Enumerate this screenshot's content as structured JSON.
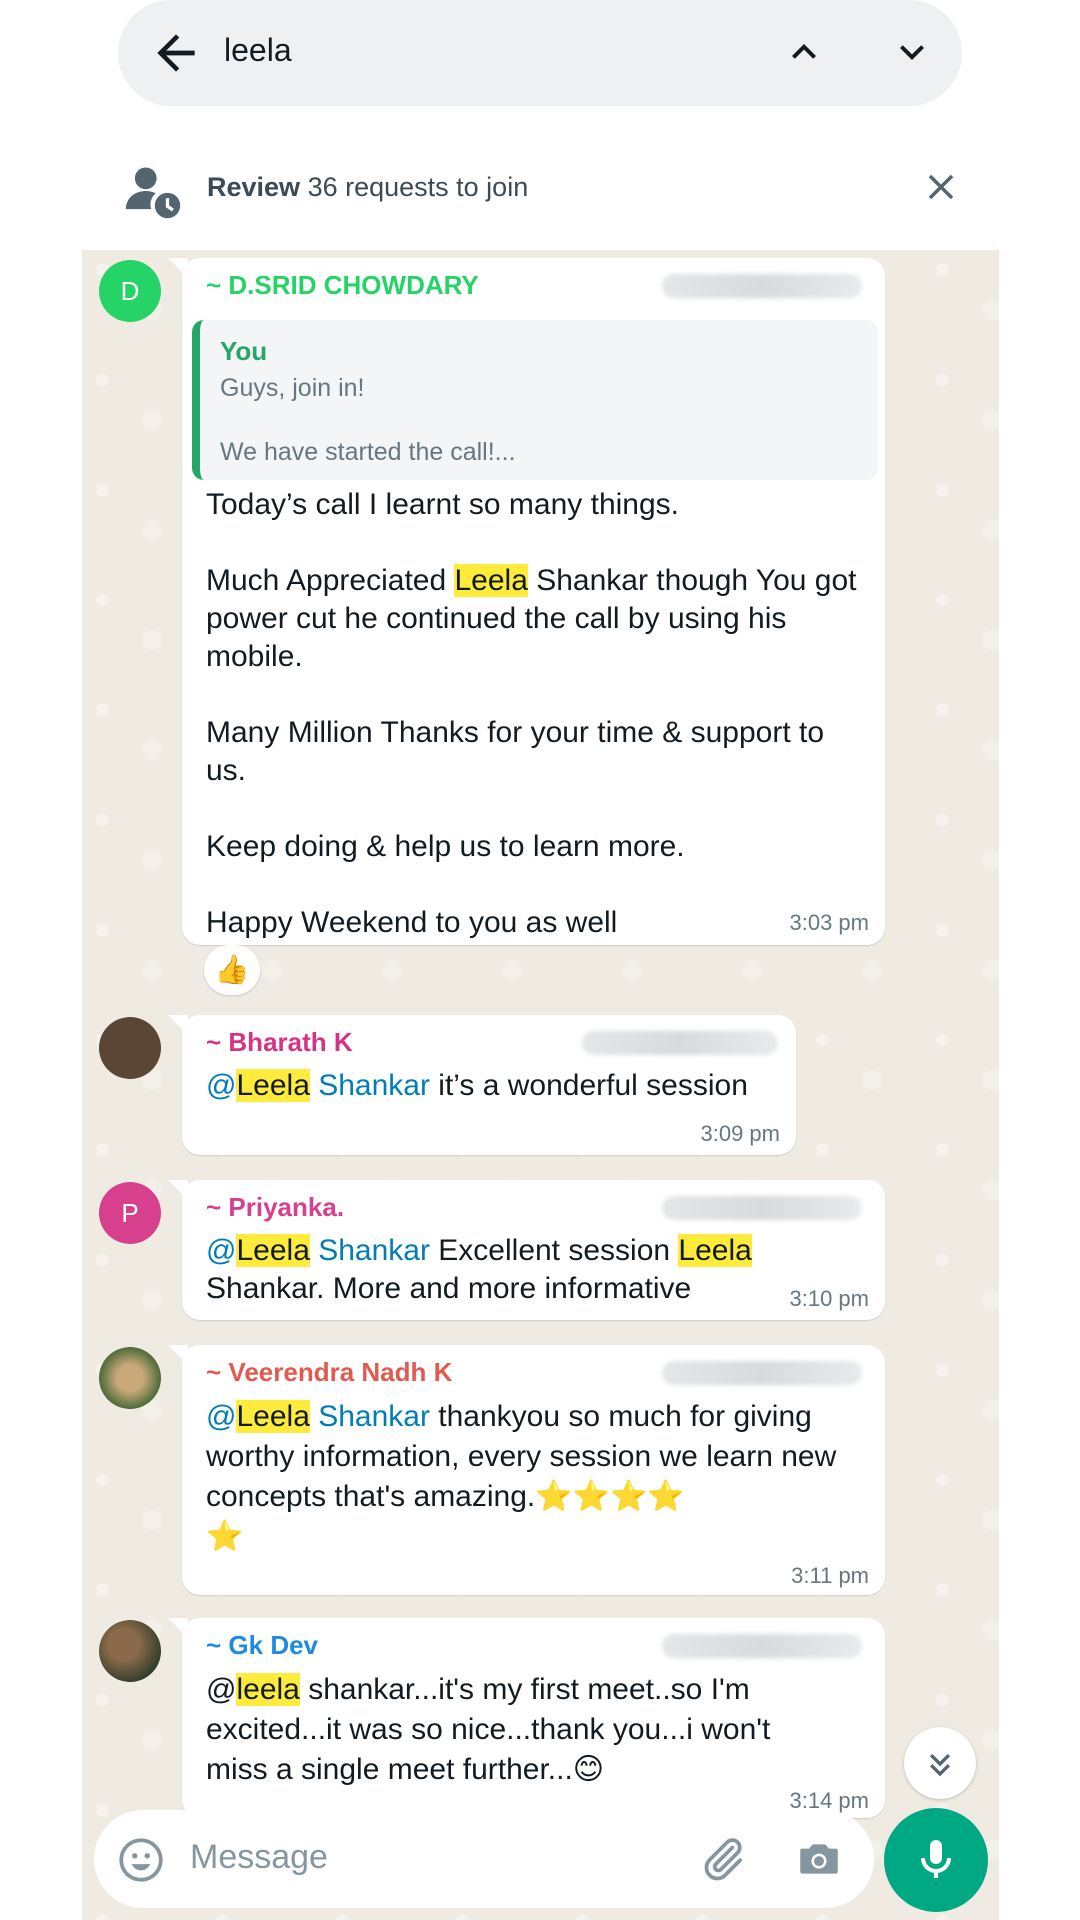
{
  "search": {
    "query": "leela"
  },
  "review_banner": {
    "bold": "Review",
    "rest": " 36 requests to join"
  },
  "colors": {
    "accent": "#00a884",
    "highlight": "#ffeb3b",
    "mention": "#027eb5"
  },
  "messages": [
    {
      "sender": "~ D.SRID CHOWDARY",
      "avatar_letter": "D",
      "sender_color": "#25d366",
      "quote": {
        "author": "You",
        "text": "Guys, join in!\n\nWe have started the call!..."
      },
      "time": "3:03 pm",
      "reaction": "👍"
    },
    {
      "sender": "~ Bharath K",
      "sender_color": "#d63384",
      "time": "3:09 pm"
    },
    {
      "sender": "~ Priyanka.",
      "avatar_letter": "P",
      "sender_color": "#d6408d",
      "time": "3:10 pm"
    },
    {
      "sender": "~ Veerendra Nadh K",
      "sender_color": "#e05a4f",
      "time": "3:11 pm"
    },
    {
      "sender": "~ Gk Dev",
      "sender_color": "#1f8be0",
      "time": "3:14 pm"
    }
  ],
  "message_texts": {
    "m1_p1": "Today’s call I learnt so many things.",
    "m1_p2a": "Much Appreciated ",
    "m1_p2_hl": "Leela",
    "m1_p2b": " Shankar though You got power cut he continued the call by using his mobile.",
    "m1_p3": "Many Million Thanks for your time & support to us.",
    "m1_p4": "Keep doing & help us to learn more.",
    "m1_p5": "Happy Weekend to you as well",
    "m2_at": "@",
    "m2_hl": "Leela",
    "m2_mention": " Shankar",
    "m2_rest": " it’s a wonderful session",
    "m3_at": "@",
    "m3_hl": "Leela",
    "m3_mention": " Shankar",
    "m3_mid": " Excellent session ",
    "m3_hl2": "Leela",
    "m3_rest": " Shankar. More and more informative",
    "m4_at": "@",
    "m4_hl": "Leela",
    "m4_mention": " Shankar",
    "m4_rest": " thankyou so much for giving worthy information, every session we learn new concepts that's amazing.⭐⭐⭐⭐",
    "m4_extra": "⭐",
    "m5_at": "@",
    "m5_hl": "leela",
    "m5_rest": " shankar...it's my first meet..so I'm excited...it was so nice...thank you...i won't miss a single meet further...😊"
  },
  "composer": {
    "placeholder": "Message"
  }
}
